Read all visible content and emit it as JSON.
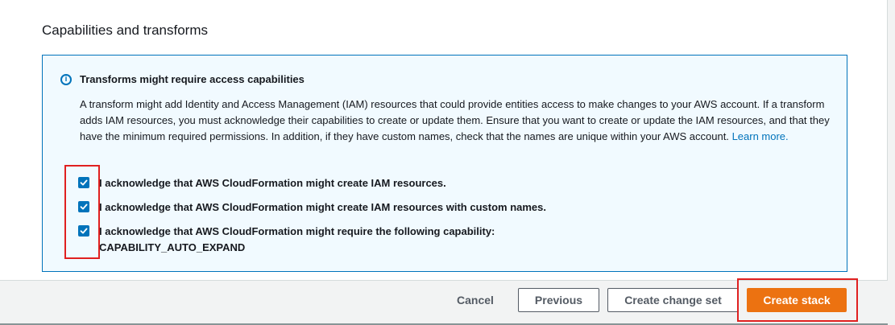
{
  "section": {
    "title": "Capabilities and transforms"
  },
  "info": {
    "title": "Transforms might require access capabilities",
    "body_text": "A transform might add Identity and Access Management (IAM) resources that could provide entities access to make changes to your AWS account. If a transform adds IAM resources, you must acknowledge their capabilities to create or update them. Ensure that you want to create or update the IAM resources, and that they have the minimum required permissions. In addition, if they have custom names, check that the names are unique within your AWS account.",
    "learn_more": "Learn more."
  },
  "acknowledgements": [
    {
      "label": "I acknowledge that AWS CloudFormation might create IAM resources.",
      "checked": true
    },
    {
      "label": "I acknowledge that AWS CloudFormation might create IAM resources with custom names.",
      "checked": true
    },
    {
      "label": "I acknowledge that AWS CloudFormation might require the following capability:",
      "label_line2": "CAPABILITY_AUTO_EXPAND",
      "checked": true
    }
  ],
  "buttons": {
    "cancel": "Cancel",
    "previous": "Previous",
    "create_change_set": "Create change set",
    "create_stack": "Create stack"
  },
  "colors": {
    "accent": "#0073bb",
    "primary_button": "#ec7211",
    "highlight": "#e02020",
    "info_background": "#f1faff"
  },
  "icons": {
    "info": "info-icon",
    "checkbox": "checkmark-icon"
  }
}
